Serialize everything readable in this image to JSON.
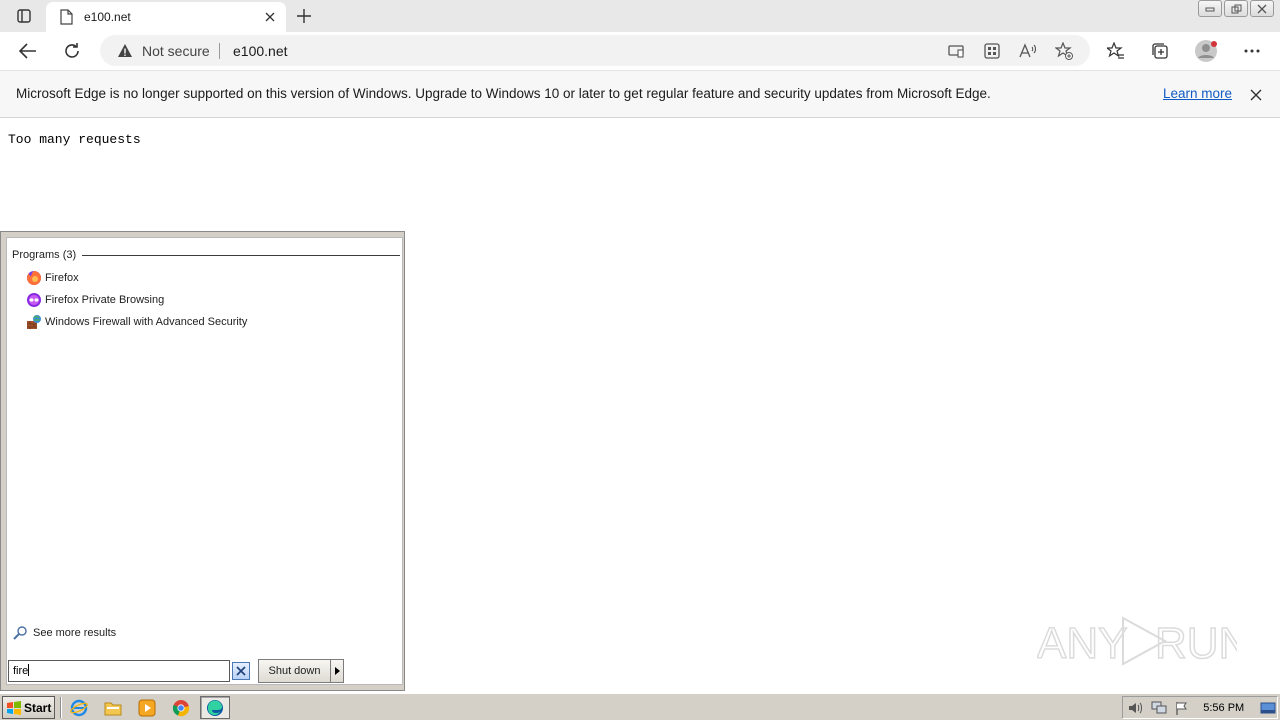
{
  "browser": {
    "tab": {
      "title": "e100.net"
    },
    "address": {
      "security_label": "Not secure",
      "url": "e100.net"
    }
  },
  "infobar": {
    "message": "Microsoft Edge is no longer supported on this version of Windows. Upgrade to Windows 10 or later to get regular feature and security updates from Microsoft Edge.",
    "link_label": "Learn more"
  },
  "page": {
    "body_text": "Too many requests"
  },
  "start_menu": {
    "section_title": "Programs (3)",
    "items": [
      {
        "label": "Firefox",
        "icon": "firefox-icon"
      },
      {
        "label": "Firefox Private Browsing",
        "icon": "firefox-private-icon"
      },
      {
        "label": "Windows Firewall with Advanced Security",
        "icon": "firewall-icon"
      }
    ],
    "see_more_label": "See more results",
    "search_value": "fire",
    "shutdown_label": "Shut down"
  },
  "taskbar": {
    "start_label": "Start",
    "apps": [
      "internet-explorer-icon",
      "file-explorer-icon",
      "media-player-icon",
      "chrome-icon",
      "edge-icon"
    ],
    "clock": "5:56 PM"
  },
  "watermark": {
    "text": "ANY RUN"
  },
  "colors": {
    "link": "#0f5bc4",
    "titlebar": "#e8e8e8",
    "classic_face": "#d4d0c8"
  }
}
